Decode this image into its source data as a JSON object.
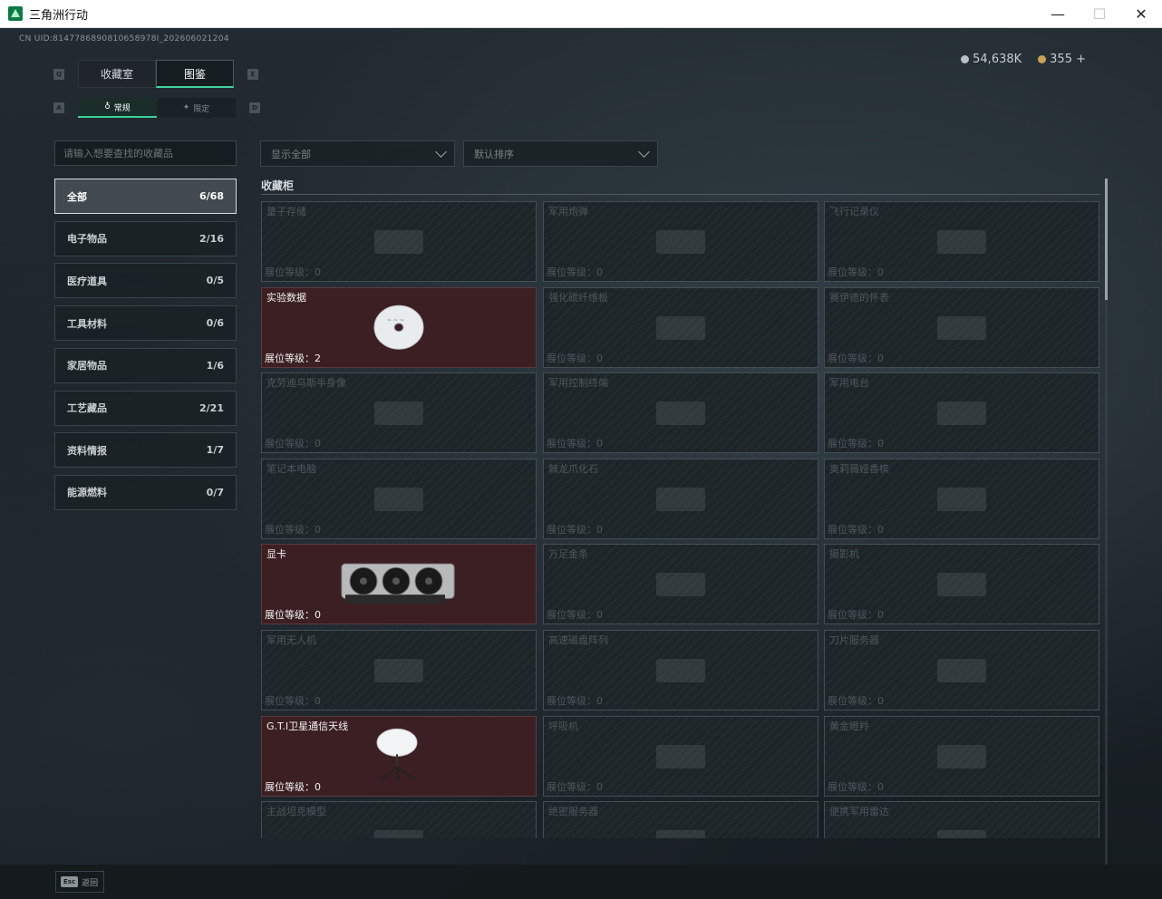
{
  "window": {
    "title": "三角洲行动",
    "minimize": "—",
    "maximize": "☐",
    "close": "✕"
  },
  "header": {
    "uid": "CN UID:8147786890810658978I_202606021204",
    "currency": [
      {
        "icon": "silver-coin-icon",
        "value": "54,638K"
      },
      {
        "icon": "gold-coin-icon",
        "value": "355 +"
      }
    ]
  },
  "tabs": {
    "main": [
      {
        "label": "收藏室",
        "active": false
      },
      {
        "label": "图鉴",
        "active": true
      }
    ],
    "sub": [
      {
        "label": "常规",
        "active": true
      },
      {
        "label": "限定",
        "active": false
      }
    ],
    "keys": {
      "prev_main": "Q",
      "next_main": "E",
      "prev_sub": "A",
      "next_sub": "D"
    }
  },
  "search": {
    "placeholder": "请输入想要查找的收藏品"
  },
  "categories": [
    {
      "label": "全部",
      "count": "6/68",
      "active": true
    },
    {
      "label": "电子物品",
      "count": "2/16",
      "active": false
    },
    {
      "label": "医疗道具",
      "count": "0/5",
      "active": false
    },
    {
      "label": "工具材料",
      "count": "0/6",
      "active": false
    },
    {
      "label": "家居物品",
      "count": "1/6",
      "active": false
    },
    {
      "label": "工艺藏品",
      "count": "2/21",
      "active": false
    },
    {
      "label": "资料情报",
      "count": "1/7",
      "active": false
    },
    {
      "label": "能源燃料",
      "count": "0/7",
      "active": false
    }
  ],
  "filters": {
    "display": "显示全部",
    "sort": "默认排序"
  },
  "section_title": "收藏柜",
  "level_label": "展位等级：",
  "items": [
    {
      "name": "量子存储",
      "level": "0",
      "owned": false
    },
    {
      "name": "军用炮弹",
      "level": "0",
      "owned": false
    },
    {
      "name": "飞行记录仪",
      "level": "0",
      "owned": false
    },
    {
      "name": "实验数据",
      "level": "2",
      "owned": true,
      "image": "disc"
    },
    {
      "name": "强化碳纤维板",
      "level": "0",
      "owned": false
    },
    {
      "name": "赛伊德的怀表",
      "level": "0",
      "owned": false
    },
    {
      "name": "克劳迪乌斯半身像",
      "level": "0",
      "owned": false
    },
    {
      "name": "军用控制终端",
      "level": "0",
      "owned": false
    },
    {
      "name": "军用电台",
      "level": "0",
      "owned": false
    },
    {
      "name": "笔记本电脑",
      "level": "0",
      "owned": false
    },
    {
      "name": "棘龙爪化石",
      "level": "0",
      "owned": false
    },
    {
      "name": "奥莉薇娅香槟",
      "level": "0",
      "owned": false
    },
    {
      "name": "显卡",
      "level": "0",
      "owned": true,
      "image": "gpu"
    },
    {
      "name": "万足金条",
      "level": "0",
      "owned": false
    },
    {
      "name": "摄影机",
      "level": "0",
      "owned": false
    },
    {
      "name": "军用无人机",
      "level": "0",
      "owned": false
    },
    {
      "name": "高速磁盘阵列",
      "level": "0",
      "owned": false
    },
    {
      "name": "刀片服务器",
      "level": "0",
      "owned": false
    },
    {
      "name": "G.T.I卫星通信天线",
      "level": "0",
      "owned": true,
      "image": "satellite"
    },
    {
      "name": "呼吸机",
      "level": "0",
      "owned": false
    },
    {
      "name": "黄金瞪羚",
      "level": "0",
      "owned": false
    },
    {
      "name": "主战坦克模型",
      "level": "",
      "owned": false
    },
    {
      "name": "绝密服务器",
      "level": "",
      "owned": false
    },
    {
      "name": "便携军用雷达",
      "level": "",
      "owned": false
    }
  ],
  "footer": {
    "esc_key": "Esc",
    "esc_label": "返回"
  }
}
